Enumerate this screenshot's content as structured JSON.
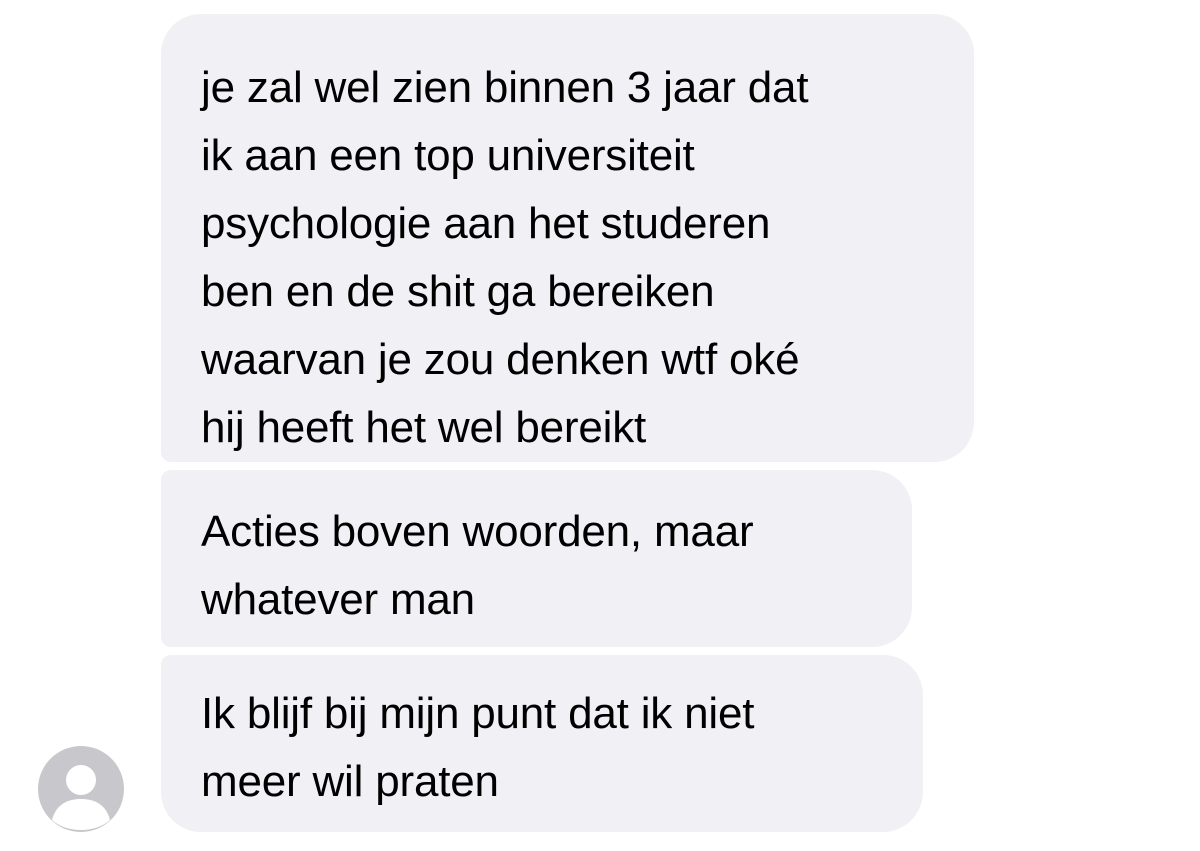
{
  "messages": [
    {
      "lines": [
        "je zal wel zien binnen 3 jaar dat",
        "ik aan een top universiteit",
        "psychologie aan het studeren",
        "ben en de shit ga bereiken",
        "waarvan je zou denken wtf oké",
        "hij heeft het wel bereikt"
      ]
    },
    {
      "lines": [
        "Acties boven woorden, maar",
        "whatever man"
      ]
    },
    {
      "lines": [
        "Ik blijf bij mijn punt dat ik niet",
        "meer wil praten"
      ]
    }
  ],
  "avatar": {
    "icon": "person-silhouette-icon",
    "background": "#c7c7cc",
    "foreground": "#ffffff"
  },
  "colors": {
    "bubble": "#f0f0f5",
    "text": "#000000",
    "page": "#ffffff"
  }
}
